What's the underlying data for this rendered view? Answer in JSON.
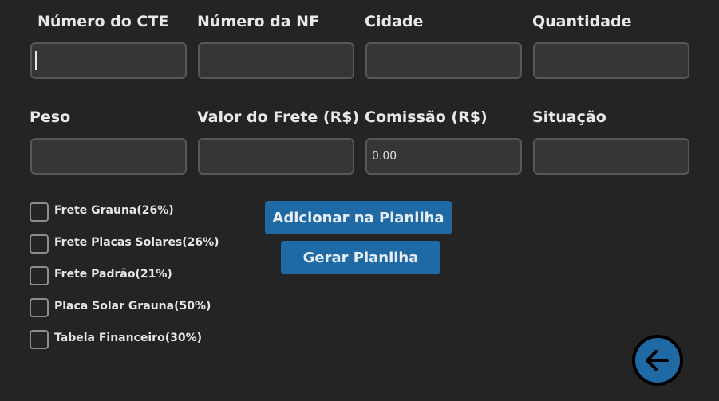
{
  "form": {
    "row1": [
      {
        "label": "Número do CTE",
        "value": ""
      },
      {
        "label": "Número da NF",
        "value": ""
      },
      {
        "label": "Cidade",
        "value": ""
      },
      {
        "label": "Quantidade",
        "value": ""
      }
    ],
    "row2": [
      {
        "label": "Peso",
        "value": ""
      },
      {
        "label": "Valor do Frete (R$)",
        "value": ""
      },
      {
        "label": "Comissão (R$)",
        "value": "0.00"
      },
      {
        "label": "Situação",
        "value": ""
      }
    ]
  },
  "checkboxes": [
    {
      "label": "Frete Grauna(26%)",
      "checked": false
    },
    {
      "label": "Frete Placas Solares(26%)",
      "checked": false
    },
    {
      "label": "Frete Padrão(21%)",
      "checked": false
    },
    {
      "label": "Placa Solar Grauna(50%)",
      "checked": false
    },
    {
      "label": "Tabela Financeiro(30%)",
      "checked": false
    }
  ],
  "buttons": {
    "add_label": "Adicionar na Planilha",
    "generate_label": "Gerar Planilha"
  },
  "colors": {
    "background": "#242424",
    "field_bg": "#343638",
    "field_border": "#555759",
    "accent": "#1f6aa5"
  },
  "icons": {
    "back": "arrow-left-icon"
  }
}
